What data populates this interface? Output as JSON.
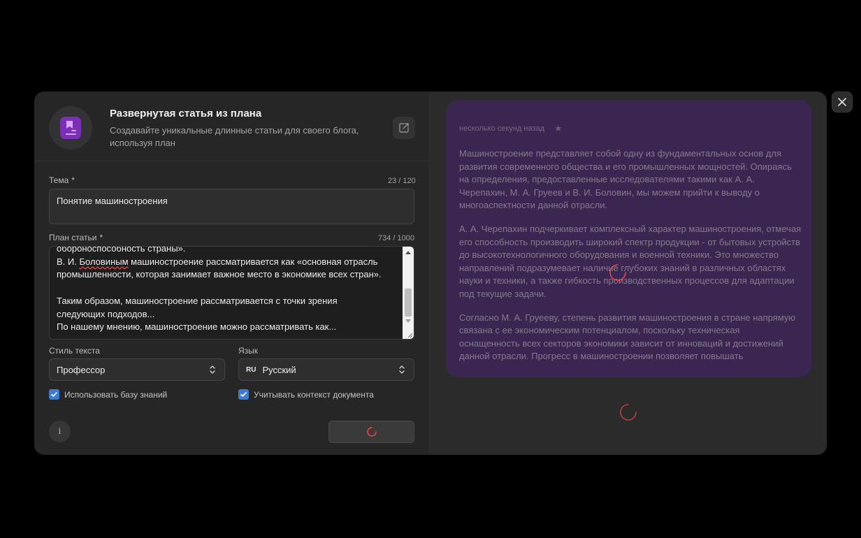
{
  "tool": {
    "title": "Развернутая статья из плана",
    "description": "Создавайте уникальные длинные статьи для своего блога, используя план",
    "accent": "#7a2fb6"
  },
  "form": {
    "topic": {
      "label": "Тема",
      "required_mark": "*",
      "counter": "23 / 120",
      "value": "Понятие машиностроения"
    },
    "plan": {
      "label": "План статьи",
      "required_mark": "*",
      "counter": "734 / 1000",
      "lines": [
        "обороноспособность страны».",
        "В. И. Боловиным машиностроение рассматривается как «основная отрасль",
        "промышленности, которая занимает важное место в экономике всех стран».",
        "",
        "Таким образом, машиностроение рассматривается с точки зрения",
        "следующих подходов...",
        "По нашему мнению, машиностроение можно рассматривать как..."
      ],
      "misspelled_word": "Боловиным"
    },
    "style": {
      "label": "Стиль текста",
      "value": "Профессор"
    },
    "language": {
      "label": "Язык",
      "code": "RU",
      "value": "Русский"
    },
    "use_knowledge_base": {
      "label": "Использовать базу знаний",
      "checked": true
    },
    "use_doc_context": {
      "label": "Учитывать контекст документа",
      "checked": true
    },
    "check_color": "#3a7bd5"
  },
  "result": {
    "timestamp": "несколько секунд назад",
    "paragraphs": [
      "Машиностроение представляет собой одну из фундаментальных основ для развития современного общества и его промышленных мощностей. Опираясь на определения, предоставленные исследователями такими как А. А. Черепахин, М. А. Груеев и В. И. Боловин, мы можем прийти к выводу о многоаспектности данной отрасли.",
      "А. А. Черепахин подчеркивает комплексный характер машиностроения, отмечая его способность производить широкий спектр продукции - от бытовых устройств до высокотехнологичного оборудования и военной техники. Это множество направлений подразумевает наличие глубоких знаний в различных областях науки и техники, а также гибкость производственных процессов для адаптации под текущие задачи.",
      "Согласно М. А. Груееву, степень развития машиностроения в стране напрямую связана с ее экономическим потенциалом, поскольку техническая оснащенность всех секторов экономики зависит от инноваций и достижений данной отрасли. Прогресс в машиностроении позволяет повышать"
    ],
    "card_color": "#3b2651",
    "spinner_color": "#e0484a"
  }
}
